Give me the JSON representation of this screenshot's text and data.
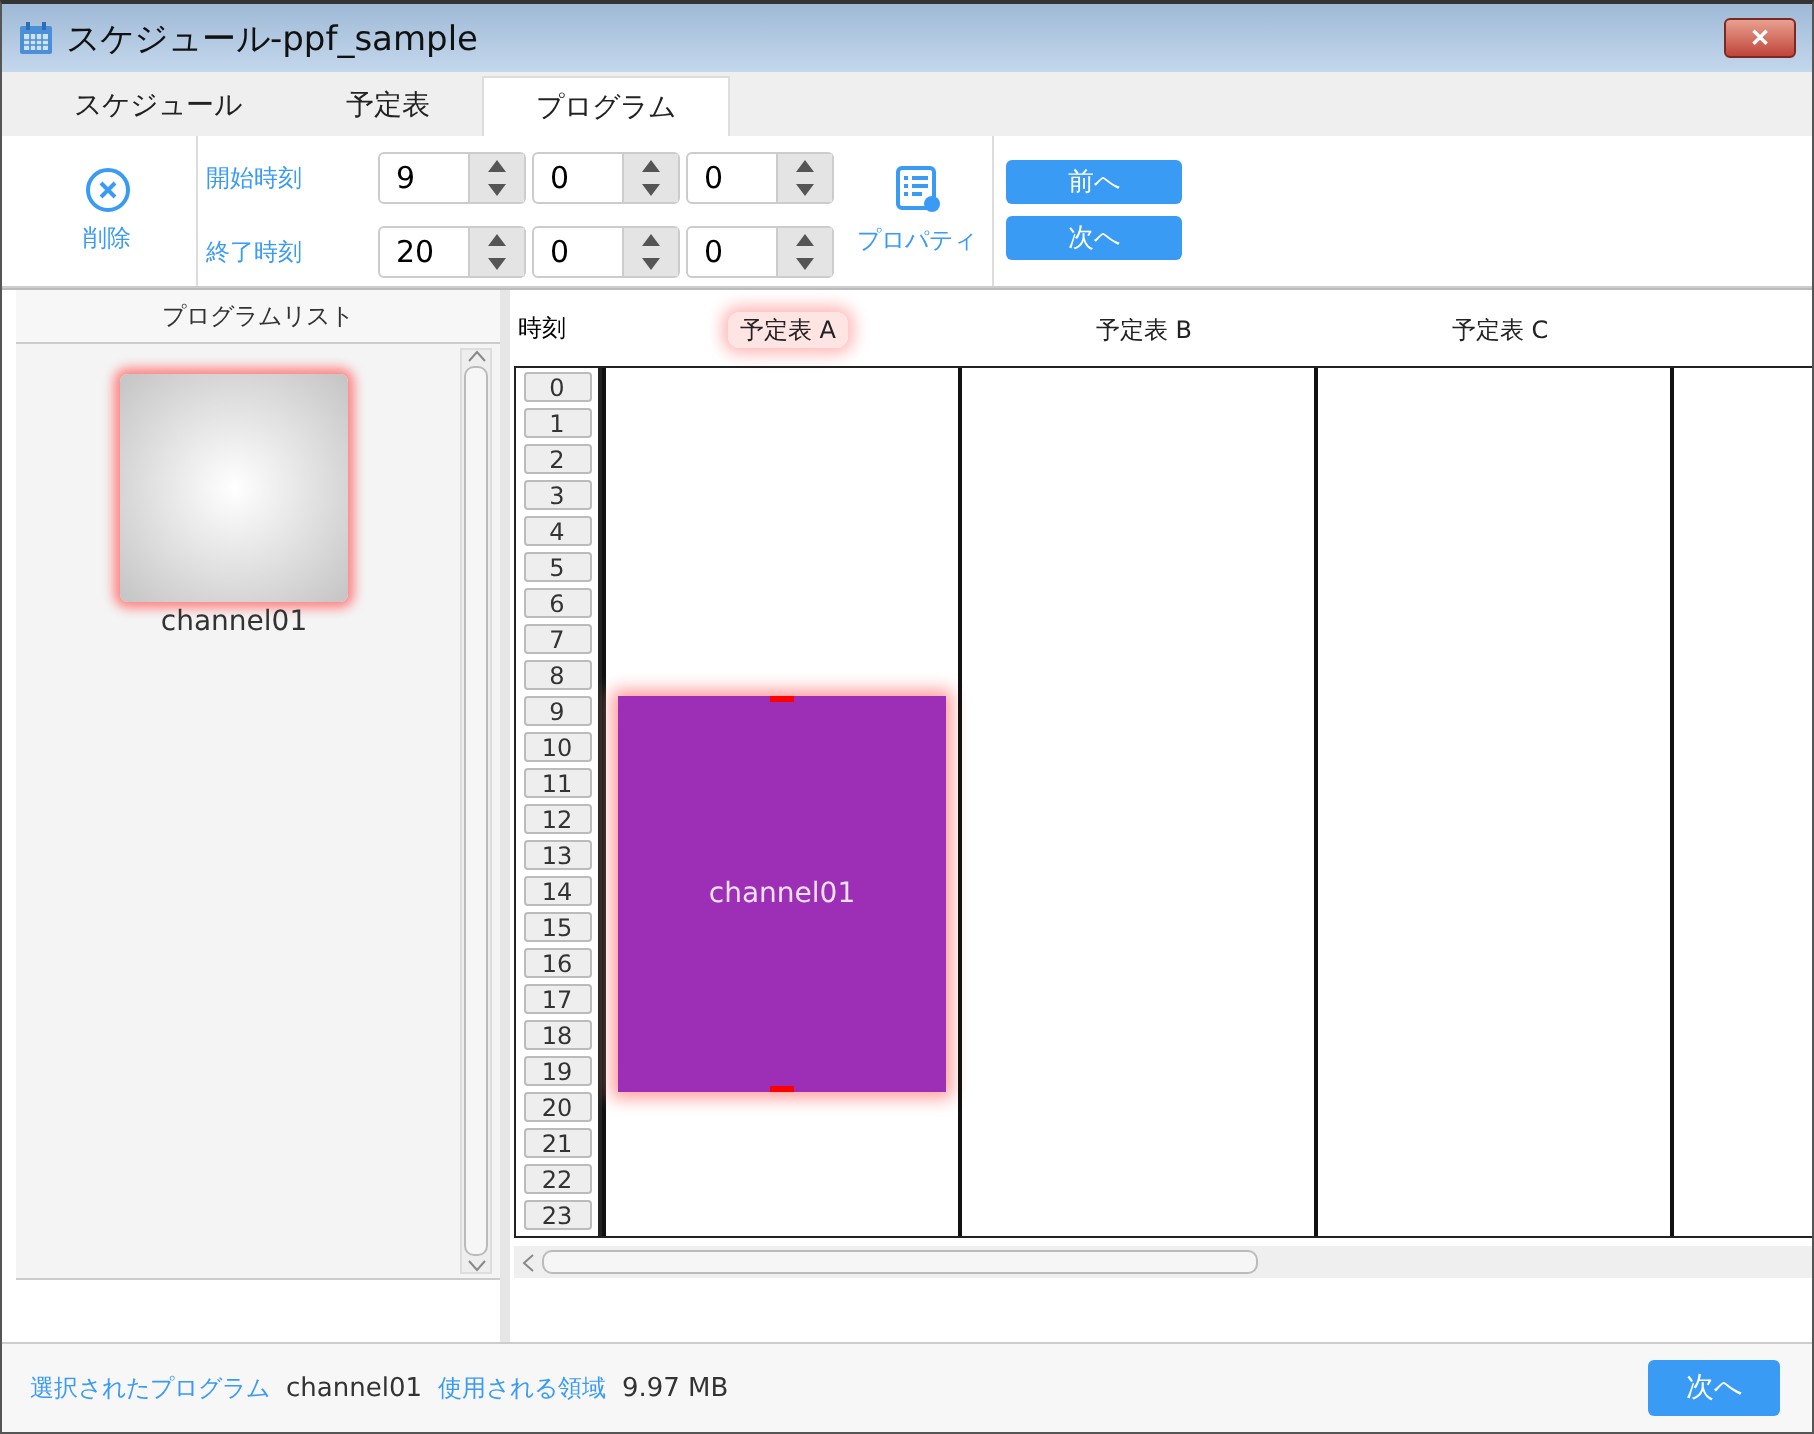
{
  "window": {
    "title": "スケジュール-ppf_sample",
    "close": "✕"
  },
  "tabs": [
    {
      "label": "スケジュール",
      "selected": false
    },
    {
      "label": "予定表",
      "selected": false
    },
    {
      "label": "プログラム",
      "selected": true
    }
  ],
  "toolbar": {
    "delete": "削除",
    "start_label": "開始時刻",
    "end_label": "終了時刻",
    "start": [
      {
        "value": "9"
      },
      {
        "value": "0"
      },
      {
        "value": "0"
      }
    ],
    "end": [
      {
        "value": "20"
      },
      {
        "value": "0"
      },
      {
        "value": "0"
      }
    ],
    "properties": "プロパティ",
    "prev": "前へ",
    "next": "次へ"
  },
  "program_list": {
    "title": "プログラムリスト",
    "items": [
      {
        "label": "channel01",
        "selected": true
      }
    ]
  },
  "schedule": {
    "time_header": "時刻",
    "hours": [
      "0",
      "1",
      "2",
      "3",
      "4",
      "5",
      "6",
      "7",
      "8",
      "9",
      "10",
      "11",
      "12",
      "13",
      "14",
      "15",
      "16",
      "17",
      "18",
      "19",
      "20",
      "21",
      "22",
      "23"
    ],
    "columns": [
      {
        "label": "予定表 A",
        "selected": true,
        "programs": [
          {
            "label": "channel01",
            "selected": true,
            "color": "#9c2fb5"
          }
        ]
      },
      {
        "label": "予定表 B",
        "selected": false
      },
      {
        "label": "予定表 C",
        "selected": false
      }
    ]
  },
  "status_bar": {
    "program_label": "選択されたプログラム",
    "program": "channel01",
    "size_label": "使用される領域",
    "size": "9.97 MB",
    "next": "次へ"
  }
}
